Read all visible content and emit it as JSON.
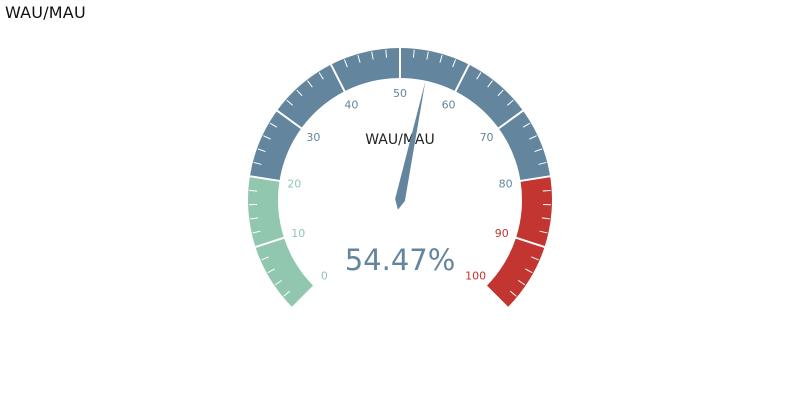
{
  "page": {
    "title": "WAU/MAU"
  },
  "chart_data": {
    "type": "gauge",
    "title": "WAU/MAU",
    "value": 54.47,
    "value_label": "54.47%",
    "min": 0,
    "max": 100,
    "start_angle_deg": 225,
    "end_angle_deg": -45,
    "major_ticks": [
      0,
      10,
      20,
      30,
      40,
      50,
      60,
      70,
      80,
      90,
      100
    ],
    "tick_labels": [
      "0",
      "10",
      "20",
      "30",
      "40",
      "50",
      "60",
      "70",
      "80",
      "90",
      "100"
    ],
    "minor_divisions": 5,
    "ranges": [
      {
        "from": 0,
        "to": 20,
        "color": "#91c7ae"
      },
      {
        "from": 20,
        "to": 80,
        "color": "#63869e"
      },
      {
        "from": 80,
        "to": 100,
        "color": "#c23531"
      }
    ],
    "pointer_color": "#63869e",
    "value_color": "#63869e"
  }
}
